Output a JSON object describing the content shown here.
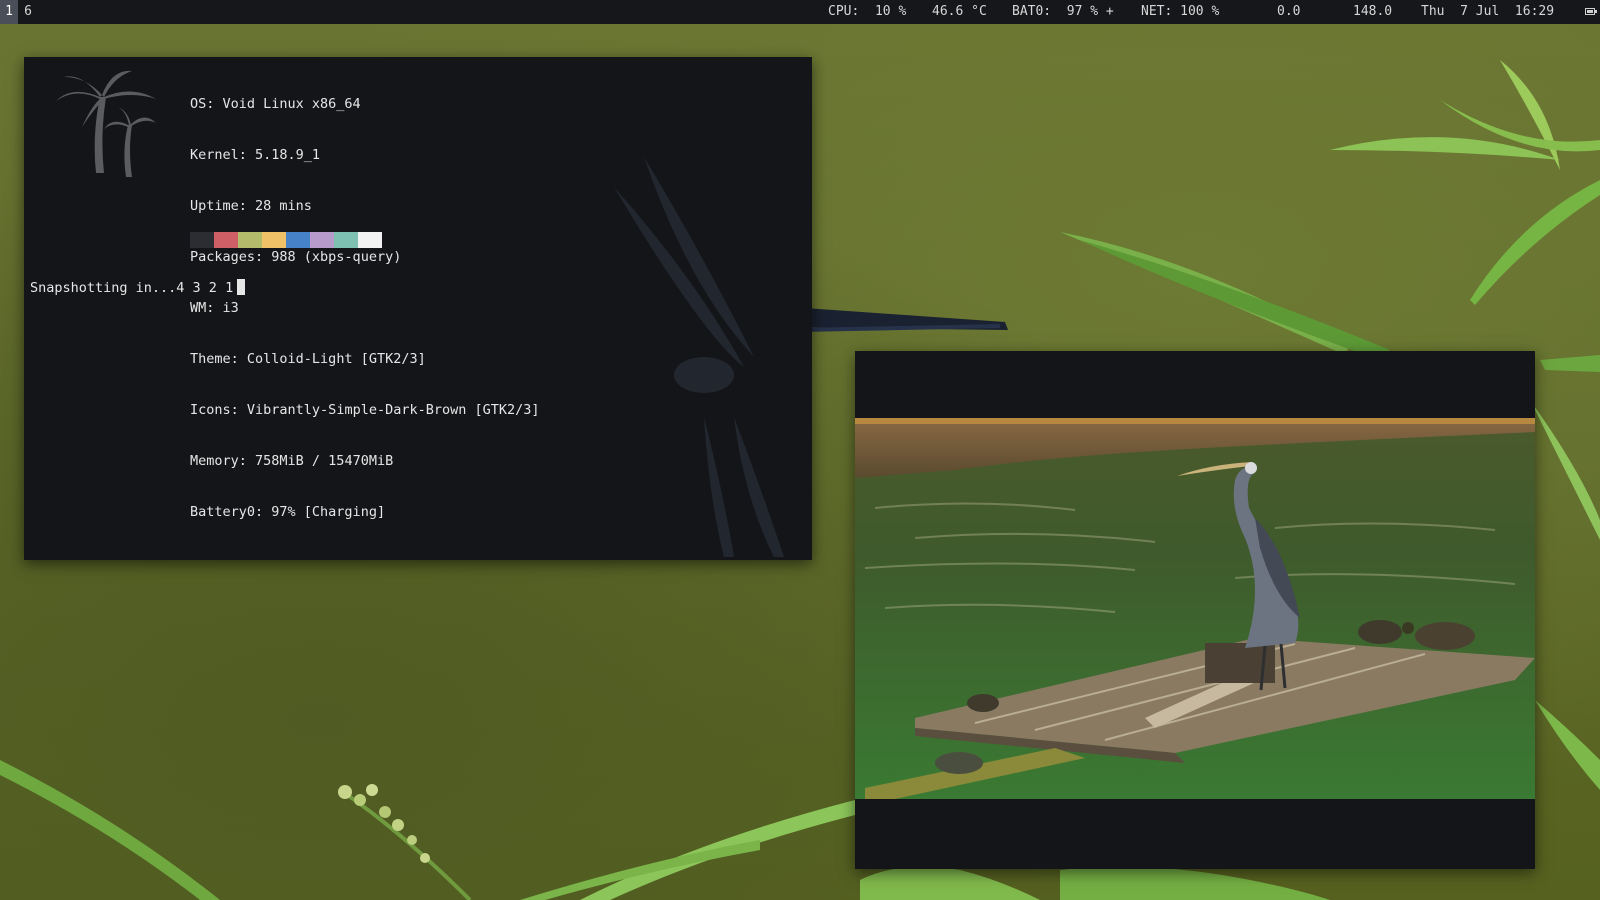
{
  "workspaces": [
    "1",
    "6"
  ],
  "status": {
    "cpu": "CPU:  10 %",
    "temp": "46.6 °C",
    "battery": "BAT0:  97 % +",
    "net": "NET: 100 %",
    "load": "0.0",
    "value": "148.0",
    "datetime": "Thu  7 Jul  16:29"
  },
  "terminal": {
    "sysinfo": [
      {
        "key": "OS:",
        "value": " Void Linux x86_64"
      },
      {
        "key": "Kernel:",
        "value": " 5.18.9_1"
      },
      {
        "key": "Uptime:",
        "value": " 28 mins"
      },
      {
        "key": "Packages:",
        "value": " 988 (xbps-query)"
      },
      {
        "key": "WM:",
        "value": " i3"
      },
      {
        "key": "Theme:",
        "value": " Colloid-Light [GTK2/3]"
      },
      {
        "key": "Icons:",
        "value": " Vibrantly-Simple-Dark-Brown [GTK2/3]"
      },
      {
        "key": "Memory:",
        "value": " 758MiB / 15470MiB"
      },
      {
        "key": "Battery0:",
        "value": " 97% [Charging]"
      }
    ],
    "palette": [
      "#2b2d33",
      "#cf5f66",
      "#b4bb6b",
      "#f0c166",
      "#4682c8",
      "#b69bcb",
      "#7ec0b1",
      "#f2f2f2"
    ],
    "prompt": "Snapshotting in...4 3 2 1"
  },
  "icons": {
    "logo": "palm-tree-icon",
    "battery": "battery-icon"
  }
}
